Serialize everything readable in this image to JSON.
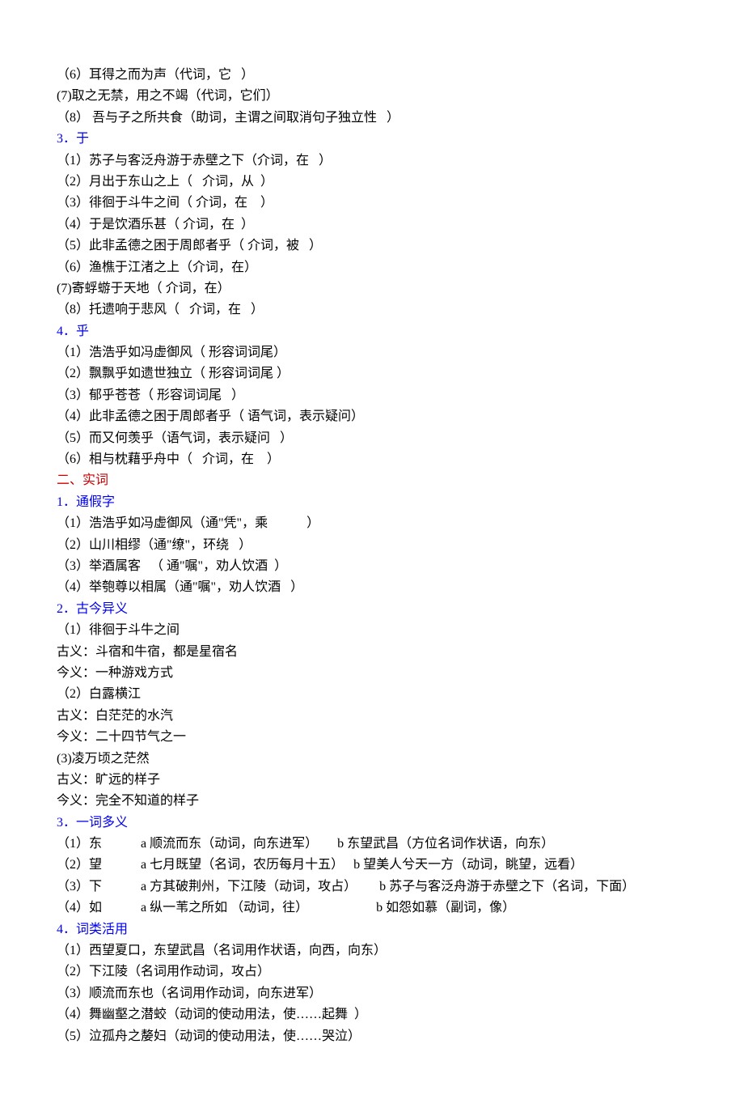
{
  "lines": [
    {
      "t": "（6）耳得之而为声（代词，它   ）"
    },
    {
      "t": "(7)取之无禁，用之不竭（代词，它们）"
    },
    {
      "t": "（8） 吾与子之所共食（助词，主谓之间取消句子独立性   ）"
    },
    {
      "t": "3．于",
      "c": "blue"
    },
    {
      "t": "（1）苏子与客泛舟游于赤壁之下（介词，在   ）"
    },
    {
      "t": "（2）月出于东山之上（   介词，从  ）"
    },
    {
      "t": "（3）徘徊于斗牛之间（ 介词，在    ）"
    },
    {
      "t": "（4）于是饮酒乐甚（ 介词，在  ）"
    },
    {
      "t": "（5）此非孟德之困于周郎者乎（ 介词，被   ）"
    },
    {
      "t": "（6）渔樵于江渚之上（介词，在）"
    },
    {
      "t": "(7)寄蜉蝣于天地（ 介词，在）"
    },
    {
      "t": "（8）托遗响于悲风（   介词，在   ）"
    },
    {
      "t": "4．乎",
      "c": "blue"
    },
    {
      "t": "（1）浩浩乎如冯虚御风（ 形容词词尾）"
    },
    {
      "t": "（2）飘飘乎如遗世独立（ 形容词词尾 ）"
    },
    {
      "t": "（3）郁乎苍苍（ 形容词词尾   ）"
    },
    {
      "t": "（4）此非孟德之困于周郎者乎（ 语气词，表示疑问）"
    },
    {
      "t": "（5）而又何羡乎（语气词，表示疑问   ）"
    },
    {
      "t": "（6）相与枕藉乎舟中（   介词，在    ）"
    },
    {
      "t": "二、实词",
      "c": "red"
    },
    {
      "t": "1．通假字",
      "c": "blue"
    },
    {
      "t": "（1）浩浩乎如冯虚御风（通\"凭\"，乘            ）"
    },
    {
      "t": "（2）山川相缪（通\"缭\"，环绕   ）"
    },
    {
      "t": "（3）举酒属客   （ 通\"嘱\"，劝人饮酒  ）"
    },
    {
      "t": "（4）举匏尊以相属（通\"嘱\"，劝人饮酒   ）"
    },
    {
      "t": "2．古今异义",
      "c": "blue"
    },
    {
      "t": "（1）徘徊于斗牛之间"
    },
    {
      "t": "古义：斗宿和牛宿，都是星宿名"
    },
    {
      "t": "今义：一种游戏方式"
    },
    {
      "t": "（2）白露横江"
    },
    {
      "t": "古义：白茫茫的水汽"
    },
    {
      "t": "今义：二十四节气之一"
    },
    {
      "t": "(3)凌万顷之茫然"
    },
    {
      "t": "古义：旷远的样子"
    },
    {
      "t": "今义：完全不知道的样子"
    },
    {
      "t": "3．一词多义",
      "c": "blue"
    },
    {
      "t": "（1）东            a 顺流而东（动词，向东进军）      b 东望武昌（方位名词作状语，向东）"
    },
    {
      "t": "（2）望            a 七月既望（名词，农历每月十五）   b 望美人兮天一方（动词，眺望，远看）"
    },
    {
      "t": "（3）下            a 方其破荆州，下江陵（动词，攻占）       b 苏子与客泛舟游于赤壁之下（名词，下面）"
    },
    {
      "t": "（4）如            a 纵一苇之所如 （动词，往）                     b 如怨如慕（副词，像）"
    },
    {
      "t": "4．词类活用",
      "c": "blue"
    },
    {
      "t": "（1）西望夏口，东望武昌（名词用作状语，向西，向东）"
    },
    {
      "t": "（2）下江陵（名词用作动词，攻占）"
    },
    {
      "t": "（3）顺流而东也（名词用作动词，向东进军）"
    },
    {
      "t": "（4）舞幽壑之潜蛟（动词的使动用法，使……起舞  ）"
    },
    {
      "t": "（5）泣孤舟之嫠妇（动词的使动用法，使……哭泣）"
    }
  ]
}
